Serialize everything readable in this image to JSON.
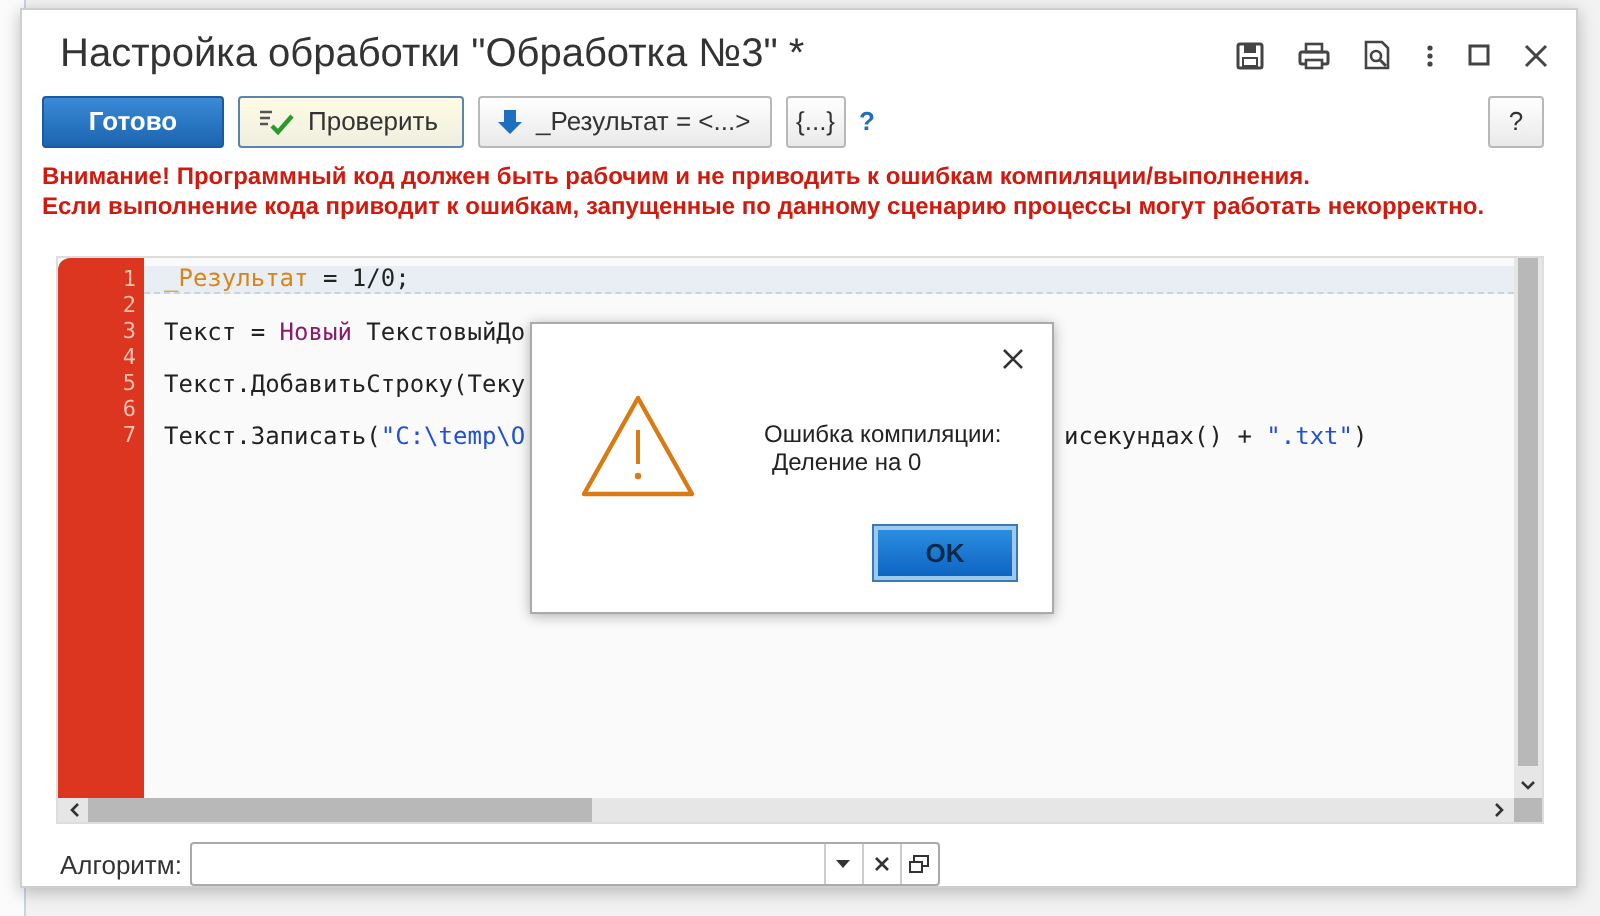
{
  "window": {
    "title": "Настройка обработки \"Обработка №3\" *"
  },
  "toolbar": {
    "buttons": [
      {
        "label": "Готово",
        "kind": "primary"
      },
      {
        "label": "Проверить",
        "kind": "check"
      },
      {
        "label": "_Результат = <...>",
        "kind": "dropdown"
      },
      {
        "label": "{...}",
        "kind": "braces"
      }
    ],
    "help_link": "?",
    "help_button": "?"
  },
  "warning": [
    "Внимание! Программный код должен быть рабочим и не приводить к ошибкам компиляции/выполнения.",
    "Если выполнение кода приводит к ошибкам, запущенные по данному сценарию процессы могут работать некорректно."
  ],
  "editor": {
    "lines": [
      {
        "number": "1",
        "current": true,
        "left": [
          {
            "kind": "variable",
            "text": "_Результат"
          },
          {
            "kind": "plain",
            "text": " = 1/0;"
          }
        ]
      },
      {
        "number": "2",
        "current": false
      },
      {
        "number": "3",
        "current": false,
        "left": [
          {
            "kind": "plain",
            "text": "Текст = "
          },
          {
            "kind": "keyword",
            "text": "Новый"
          },
          {
            "kind": "plain",
            "text": " ТекстовыйДо"
          }
        ]
      },
      {
        "number": "4",
        "current": false
      },
      {
        "number": "5",
        "current": false,
        "left": [
          {
            "kind": "plain",
            "text": "Текст.ДобавитьСтроку(Теку"
          }
        ]
      },
      {
        "number": "6",
        "current": false
      },
      {
        "number": "7",
        "current": false,
        "left": [
          {
            "kind": "plain",
            "text": "Текст.Записать("
          },
          {
            "kind": "string",
            "text": "\"C:\\temp\\О"
          }
        ],
        "right": [
          {
            "kind": "plain",
            "text": "исекундах() + "
          },
          {
            "kind": "string",
            "text": "\".txt\""
          },
          {
            "kind": "plain",
            "text": ")"
          }
        ]
      }
    ]
  },
  "dialog": {
    "message": [
      "Ошибка компиляции:",
      "Деление на 0"
    ],
    "button": "OK"
  },
  "algorithm": {
    "label": "Алгоритм:"
  }
}
